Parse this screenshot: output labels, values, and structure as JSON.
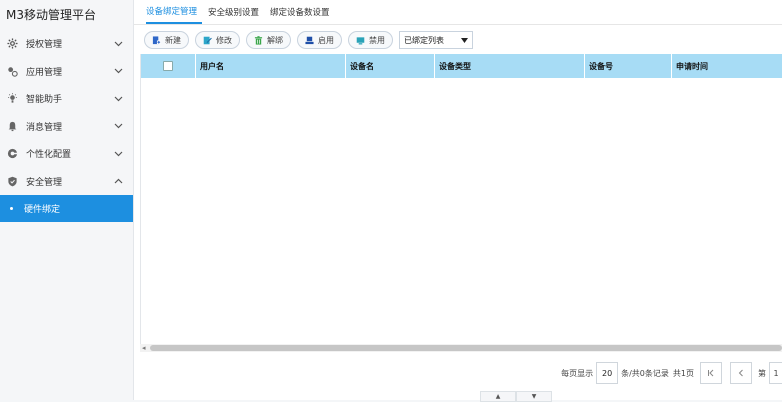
{
  "app": {
    "title": "M3移动管理平台"
  },
  "sidebar": {
    "items": [
      {
        "label": "授权管理",
        "icon": "gear-icon",
        "chevron": "down"
      },
      {
        "label": "应用管理",
        "icon": "apps-icon",
        "chevron": "down"
      },
      {
        "label": "智能助手",
        "icon": "bulb-icon",
        "chevron": "down"
      },
      {
        "label": "消息管理",
        "icon": "bell-icon",
        "chevron": "down"
      },
      {
        "label": "个性化配置",
        "icon": "palette-icon",
        "chevron": "down"
      },
      {
        "label": "安全管理",
        "icon": "shield-icon",
        "chevron": "up"
      }
    ],
    "subitems": [
      {
        "label": "硬件绑定",
        "active": true
      }
    ],
    "active_color": "#1d8fe0"
  },
  "tabs": [
    {
      "label": "设备绑定管理",
      "active": true
    },
    {
      "label": "安全级别设置",
      "active": false
    },
    {
      "label": "绑定设备数设置",
      "active": false
    }
  ],
  "toolbar": {
    "buttons": [
      {
        "label": "新建",
        "icon": "new-icon"
      },
      {
        "label": "修改",
        "icon": "edit-icon"
      },
      {
        "label": "解绑",
        "icon": "delete-icon"
      },
      {
        "label": "启用",
        "icon": "enable-icon"
      },
      {
        "label": "禁用",
        "icon": "disable-icon"
      }
    ],
    "filter_select": {
      "value": "已绑定列表"
    }
  },
  "table": {
    "columns": [
      "用户名",
      "设备名",
      "设备类型",
      "设备号",
      "申请时间"
    ],
    "rows": []
  },
  "pager": {
    "per_page_label": "每页显示",
    "per_page_value": "20",
    "records_text": "条/共0条记录",
    "pages_text": "共1页",
    "page_prefix": "第",
    "page_value": "1"
  },
  "colors": {
    "header_bg": "#a7dcf5",
    "accent": "#1d8fe0"
  }
}
